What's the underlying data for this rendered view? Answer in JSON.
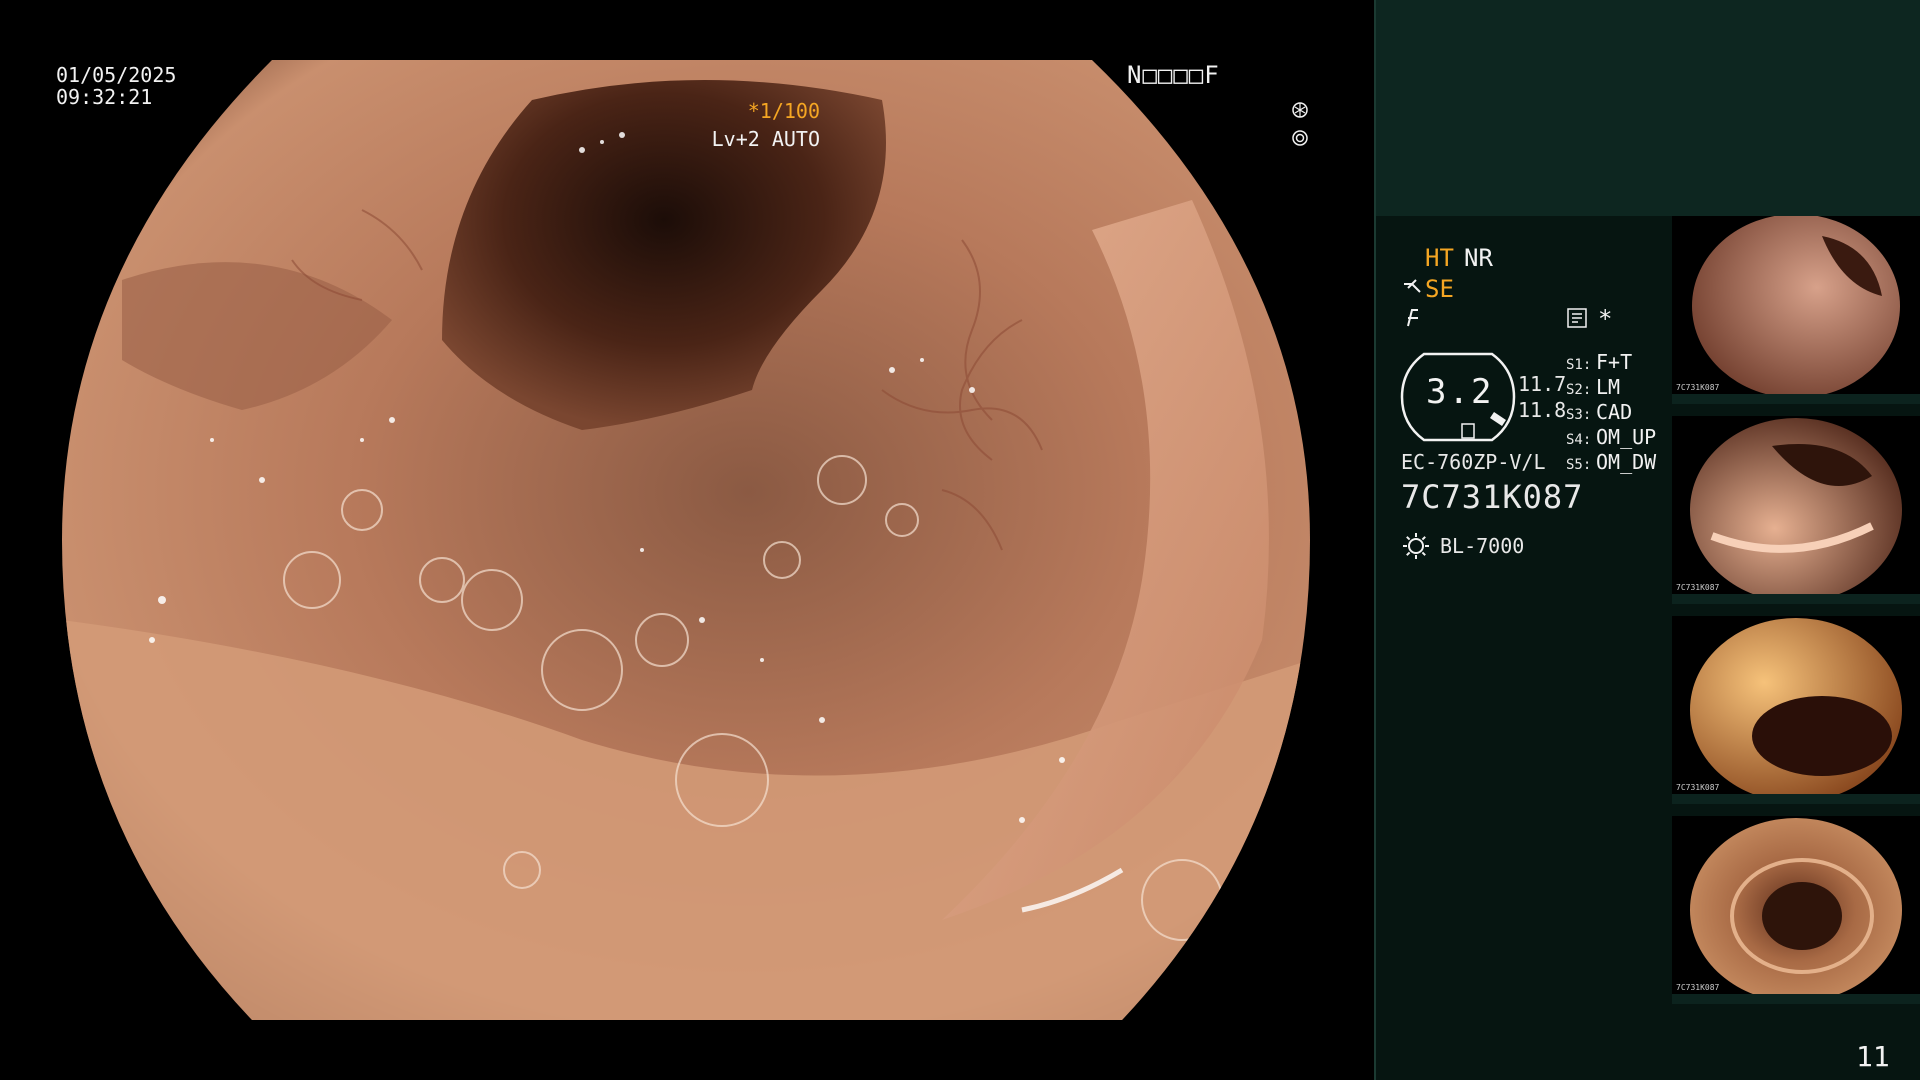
{
  "overlay": {
    "date": "01/05/2025",
    "time": "09:32:21",
    "patient_id": "N□□□□F",
    "shutter": "*1/100",
    "level": "Lv+2 AUTO"
  },
  "panel": {
    "mode_ht": "HT",
    "mode_nr": "NR",
    "mode_se": "SE",
    "star": "*",
    "zoom_value": "3.2",
    "pressure_a": "11.7",
    "pressure_b": "11.8",
    "presets": [
      {
        "key": "S1:",
        "value": "F+T"
      },
      {
        "key": "S2:",
        "value": "LM"
      },
      {
        "key": "S3:",
        "value": "CAD"
      },
      {
        "key": "S4:",
        "value": "OM_UP"
      },
      {
        "key": "S5:",
        "value": "OM_DW"
      }
    ],
    "scope_model": "EC-760ZP-V/L",
    "scope_serial": "7C731K087",
    "light_source": "BL-7000",
    "page_number": "11"
  },
  "thumbnails": [
    {
      "caption": "7C731K087"
    },
    {
      "caption": "7C731K087"
    },
    {
      "caption": "7C731K087"
    },
    {
      "caption": "7C731K087"
    }
  ],
  "colors": {
    "accent_orange": "#f5a623",
    "panel_bg": "#061511",
    "panel_top": "#0d2620"
  }
}
